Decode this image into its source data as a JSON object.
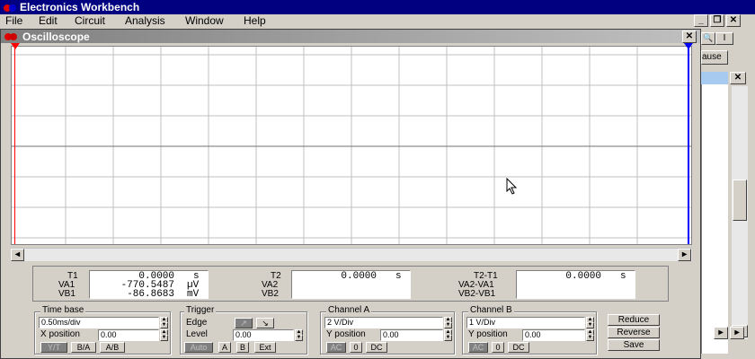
{
  "app": {
    "title": "Electronics Workbench"
  },
  "menu": [
    "File",
    "Edit",
    "Circuit",
    "Analysis",
    "Window",
    "Help"
  ],
  "background": {
    "pause_label": "ause"
  },
  "scope": {
    "title": "Oscilloscope",
    "readout": {
      "t1_label": "T1",
      "t1_value": "0.0000",
      "t1_unit": "s",
      "va1_label": "VA1",
      "va1_value": "-770.5487",
      "va1_unit": "µV",
      "vb1_label": "VB1",
      "vb1_value": "-86.8683",
      "vb1_unit": "mV",
      "t2_label": "T2",
      "t2_value": "0.0000",
      "t2_unit": "s",
      "va2_label": "VA2",
      "vb2_label": "VB2",
      "dt_label": "T2-T1",
      "dt_value": "0.0000",
      "dt_unit": "s",
      "dva_label": "VA2-VA1",
      "dvb_label": "VB2-VB1"
    },
    "timebase": {
      "title": "Time base",
      "value": "0.50ms/div",
      "xpos_label": "X position",
      "xpos_value": "0.00",
      "yt": "Y/T",
      "ba": "B/A",
      "ab": "A/B"
    },
    "trigger": {
      "title": "Trigger",
      "edge_label": "Edge",
      "edge_rise": "↗",
      "edge_fall": "↘",
      "level_label": "Level",
      "level_value": "0.00",
      "auto": "Auto",
      "a": "A",
      "b": "B",
      "ext": "Ext"
    },
    "channel_a": {
      "title": "Channel A",
      "value": "2 V/Div",
      "ypos_label": "Y position",
      "ypos_value": "0.00",
      "ac": "AC",
      "zero": "0",
      "dc": "DC"
    },
    "channel_b": {
      "title": "Channel B",
      "value": "1 V/Div",
      "ypos_label": "Y position",
      "ypos_value": "0.00",
      "ac": "AC",
      "zero": "0",
      "dc": "DC"
    },
    "buttons": {
      "reduce": "Reduce",
      "reverse": "Reverse",
      "save": "Save"
    }
  },
  "colors": {
    "title_bar": "#000080",
    "screen_bg": "#ffffff",
    "grid": "#c0c0c0",
    "cursor1": "#ff0000",
    "cursor2": "#0000ff"
  }
}
